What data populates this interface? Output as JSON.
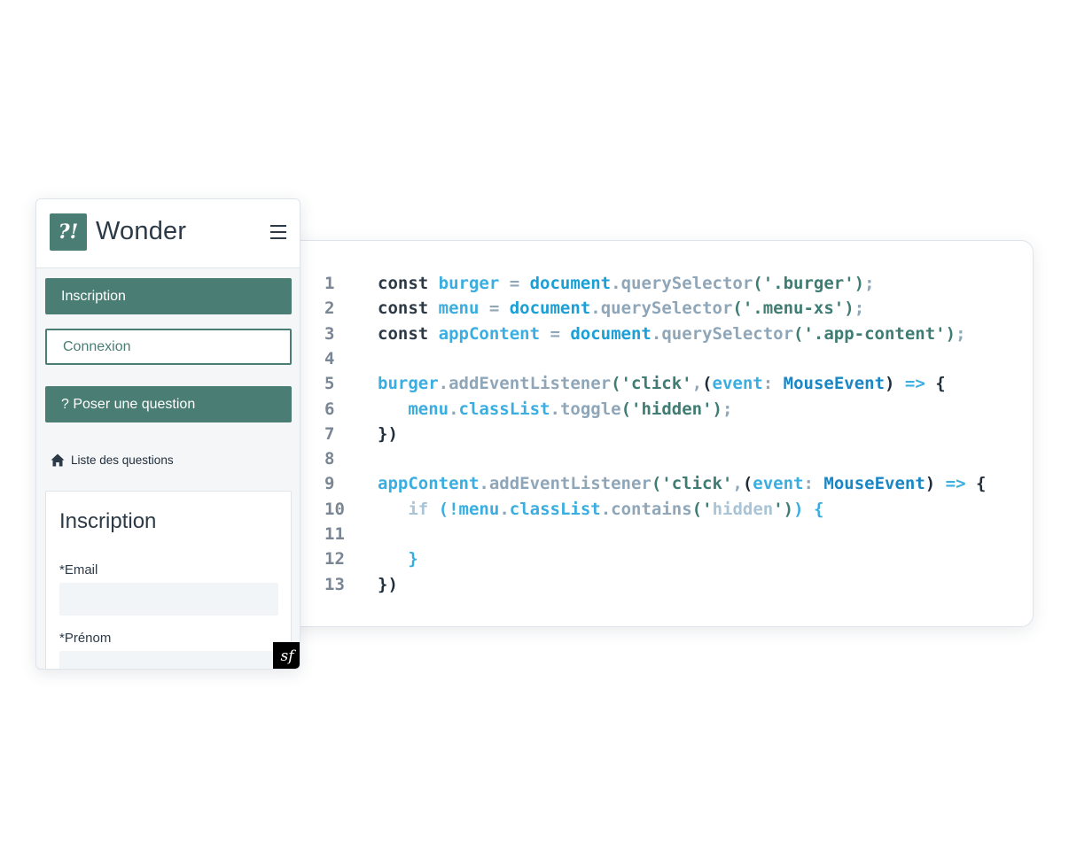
{
  "mobile": {
    "logo_text": "?!",
    "brand": "Wonder",
    "buttons": {
      "inscription": "Inscription",
      "connexion": "Connexion",
      "question": "? Poser une question"
    },
    "nav": {
      "questions_list": "Liste des questions"
    },
    "form": {
      "title": "Inscription",
      "email_label": "*Email",
      "prenom_label": "*Prénom"
    },
    "badge_text": "sf",
    "colors": {
      "primary": "#4a7d73",
      "text": "#2c3a47"
    }
  },
  "code": {
    "lines": [
      [
        {
          "t": "kw",
          "v": "const "
        },
        {
          "t": "var",
          "v": "burger"
        },
        {
          "t": "muted",
          "v": " = "
        },
        {
          "t": "obj",
          "v": "document"
        },
        {
          "t": "muted",
          "v": ".querySelector"
        },
        {
          "t": "str",
          "v": "('.burger')"
        },
        {
          "t": "muted",
          "v": ";"
        }
      ],
      [
        {
          "t": "kw",
          "v": "const "
        },
        {
          "t": "var",
          "v": "menu"
        },
        {
          "t": "muted",
          "v": " = "
        },
        {
          "t": "obj",
          "v": "document"
        },
        {
          "t": "muted",
          "v": ".querySelector"
        },
        {
          "t": "str",
          "v": "('.menu-xs')"
        },
        {
          "t": "muted",
          "v": ";"
        }
      ],
      [
        {
          "t": "kw",
          "v": "const "
        },
        {
          "t": "var",
          "v": "appContent"
        },
        {
          "t": "muted",
          "v": " = "
        },
        {
          "t": "obj",
          "v": "document"
        },
        {
          "t": "muted",
          "v": ".querySelector"
        },
        {
          "t": "str",
          "v": "('.app-content')"
        },
        {
          "t": "muted",
          "v": ";"
        }
      ],
      [],
      [
        {
          "t": "var",
          "v": "burger"
        },
        {
          "t": "muted",
          "v": ".addEventListener"
        },
        {
          "t": "str",
          "v": "('click'"
        },
        {
          "t": "muted",
          "v": ","
        },
        {
          "t": "dark",
          "v": "("
        },
        {
          "t": "var",
          "v": "event"
        },
        {
          "t": "muted",
          "v": ": "
        },
        {
          "t": "type",
          "v": "MouseEvent"
        },
        {
          "t": "dark",
          "v": ") "
        },
        {
          "t": "var",
          "v": "=> "
        },
        {
          "t": "dark",
          "v": "{"
        }
      ],
      [
        {
          "t": "kw",
          "v": "   "
        },
        {
          "t": "var",
          "v": "menu"
        },
        {
          "t": "muted",
          "v": "."
        },
        {
          "t": "var",
          "v": "classList"
        },
        {
          "t": "muted",
          "v": ".toggle"
        },
        {
          "t": "str",
          "v": "('hidden')"
        },
        {
          "t": "muted",
          "v": ";"
        }
      ],
      [
        {
          "t": "dark",
          "v": "})"
        }
      ],
      [],
      [
        {
          "t": "var",
          "v": "appContent"
        },
        {
          "t": "muted",
          "v": ".addEventListener"
        },
        {
          "t": "str",
          "v": "('click'"
        },
        {
          "t": "muted",
          "v": ","
        },
        {
          "t": "dark",
          "v": "("
        },
        {
          "t": "var",
          "v": "event"
        },
        {
          "t": "muted",
          "v": ": "
        },
        {
          "t": "type",
          "v": "MouseEvent"
        },
        {
          "t": "dark",
          "v": ") "
        },
        {
          "t": "var",
          "v": "=> "
        },
        {
          "t": "dark",
          "v": "{"
        }
      ],
      [
        {
          "t": "kw",
          "v": "   "
        },
        {
          "t": "light",
          "v": "if "
        },
        {
          "t": "var",
          "v": "(!"
        },
        {
          "t": "var",
          "v": "menu"
        },
        {
          "t": "muted",
          "v": "."
        },
        {
          "t": "var",
          "v": "classList"
        },
        {
          "t": "muted",
          "v": ".contains"
        },
        {
          "t": "str",
          "v": "('"
        },
        {
          "t": "light",
          "v": "hidden"
        },
        {
          "t": "str",
          "v": "')"
        },
        {
          "t": "var",
          "v": ") {"
        }
      ],
      [],
      [
        {
          "t": "kw",
          "v": "   "
        },
        {
          "t": "var",
          "v": "}"
        }
      ],
      [
        {
          "t": "dark",
          "v": "})"
        }
      ]
    ]
  }
}
